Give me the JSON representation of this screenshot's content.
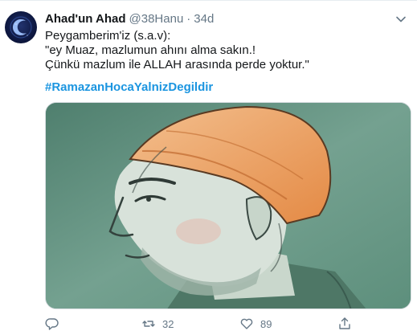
{
  "tweet": {
    "name": "Ahad'un Ahad",
    "handle": "@38Hanu",
    "separator": "·",
    "time": "34d",
    "lines": [
      "Peygamberim'iz (s.a.v):",
      "\"ey Muaz, mazlumun ahını alma sakın.!",
      "Çünkü mazlum ile ALLAH arasında perde yoktur.\""
    ],
    "hashtag": "#RamazanHocaYalnizDegildir"
  },
  "actions": {
    "reply_count": "",
    "retweet_count": "32",
    "like_count": "89"
  },
  "icons": {
    "avatar": "crescent-moon-avatar",
    "menu": "chevron-down-icon",
    "reply": "reply-icon",
    "retweet": "retweet-icon",
    "like": "heart-icon",
    "share": "share-icon"
  },
  "colors": {
    "link": "#1b95e0",
    "secondary_text": "#657786",
    "primary_text": "#14171a"
  }
}
